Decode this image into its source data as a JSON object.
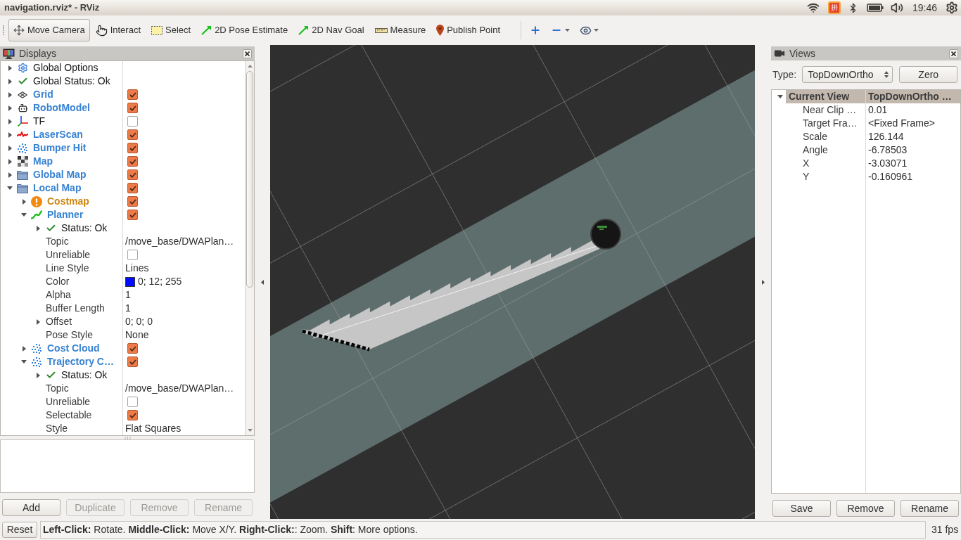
{
  "window": {
    "title": "navigation.rviz* - RViz"
  },
  "tray": {
    "input_method": "拼",
    "clock": "19:46"
  },
  "toolbar": {
    "tools": [
      {
        "label": "Move Camera",
        "kind": "move_camera",
        "selected": true
      },
      {
        "label": "Interact",
        "kind": "interact",
        "selected": false
      },
      {
        "label": "Select",
        "kind": "select",
        "selected": false
      },
      {
        "label": "2D Pose Estimate",
        "kind": "pose",
        "selected": false
      },
      {
        "label": "2D Nav Goal",
        "kind": "goal",
        "selected": false
      },
      {
        "label": "Measure",
        "kind": "measure",
        "selected": false
      },
      {
        "label": "Publish Point",
        "kind": "point",
        "selected": false
      }
    ]
  },
  "displays": {
    "title": "Displays",
    "tree": [
      {
        "label": "Global Options",
        "kind": "options",
        "expanded": false
      },
      {
        "label": "Global Status: Ok",
        "kind": "status",
        "expanded": false
      },
      {
        "label": "Grid",
        "kind": "grid",
        "expanded": false,
        "checked": true,
        "warning": false
      },
      {
        "label": "RobotModel",
        "kind": "robot_model",
        "expanded": false,
        "checked": true,
        "warning": false
      },
      {
        "label": "TF",
        "kind": "tf",
        "expanded": false,
        "checked": false,
        "warning": false
      },
      {
        "label": "LaserScan",
        "kind": "laser_scan",
        "expanded": false,
        "checked": true,
        "warning": false
      },
      {
        "label": "Bumper Hit",
        "kind": "point_cloud",
        "expanded": false,
        "checked": true,
        "warning": false
      },
      {
        "label": "Map",
        "kind": "map",
        "expanded": false,
        "checked": true,
        "warning": false
      },
      {
        "label": "Global Map",
        "kind": "group",
        "expanded": false,
        "checked": true,
        "warning": false
      },
      {
        "label": "Local Map",
        "kind": "group",
        "expanded": true,
        "checked": true,
        "warning": false,
        "children": [
          {
            "label": "Costmap",
            "kind": "map",
            "expanded": false,
            "checked": true,
            "warning": true
          },
          {
            "label": "Planner",
            "kind": "path",
            "expanded": true,
            "checked": true,
            "warning": false,
            "children": [
              {
                "label": "Status: Ok",
                "kind": "status",
                "expanded": false
              },
              {
                "label": "Topic",
                "kind": "property",
                "value": "/move_base/DWAPlan…"
              },
              {
                "label": "Unreliable",
                "kind": "property",
                "checked": false
              },
              {
                "label": "Line Style",
                "kind": "property",
                "value": "Lines"
              },
              {
                "label": "Color",
                "kind": "property",
                "color": "#000cff",
                "value": "0; 12; 255"
              },
              {
                "label": "Alpha",
                "kind": "property",
                "value": "1"
              },
              {
                "label": "Buffer Length",
                "kind": "property",
                "value": "1"
              },
              {
                "label": "Offset",
                "kind": "property",
                "expanded": false,
                "value": "0; 0; 0"
              },
              {
                "label": "Pose Style",
                "kind": "property",
                "value": "None"
              }
            ]
          },
          {
            "label": "Cost Cloud",
            "kind": "point_cloud",
            "expanded": false,
            "checked": true,
            "warning": false
          },
          {
            "label": "Trajectory C…",
            "kind": "point_cloud",
            "expanded": true,
            "checked": true,
            "warning": false,
            "children": [
              {
                "label": "Status: Ok",
                "kind": "status",
                "expanded": false
              },
              {
                "label": "Topic",
                "kind": "property",
                "value": "/move_base/DWAPlan…"
              },
              {
                "label": "Unreliable",
                "kind": "property",
                "checked": false
              },
              {
                "label": "Selectable",
                "kind": "property",
                "checked": true
              },
              {
                "label": "Style",
                "kind": "property",
                "value": "Flat Squares"
              }
            ]
          }
        ]
      }
    ],
    "buttons": [
      {
        "label": "Add",
        "disabled": false
      },
      {
        "label": "Duplicate",
        "disabled": true
      },
      {
        "label": "Remove",
        "disabled": true
      },
      {
        "label": "Rename",
        "disabled": true
      }
    ]
  },
  "views": {
    "title": "Views",
    "type_label": "Type:",
    "type_value": "TopDownOrtho",
    "zero_button": "Zero",
    "tree": [
      {
        "label": "Current View",
        "value": "TopDownOrtho …",
        "expanded": true,
        "children": [
          {
            "label": "Near Clip …",
            "value": "0.01"
          },
          {
            "label": "Target Fra…",
            "value": "<Fixed Frame>"
          },
          {
            "label": "Scale",
            "value": "126.144"
          },
          {
            "label": "Angle",
            "value": "-6.78503"
          },
          {
            "label": "X",
            "value": "-3.03071"
          },
          {
            "label": "Y",
            "value": "-0.160961"
          }
        ]
      }
    ],
    "buttons": [
      {
        "label": "Save",
        "disabled": false
      },
      {
        "label": "Remove",
        "disabled": false
      },
      {
        "label": "Rename",
        "disabled": false
      }
    ]
  },
  "status_bar": {
    "reset": "Reset",
    "message": "**Left-Click:** Rotate. **Middle-Click:** Move X/Y. **Right-Click:**: Zoom. **Shift**: More options.",
    "fps": "31 fps"
  }
}
